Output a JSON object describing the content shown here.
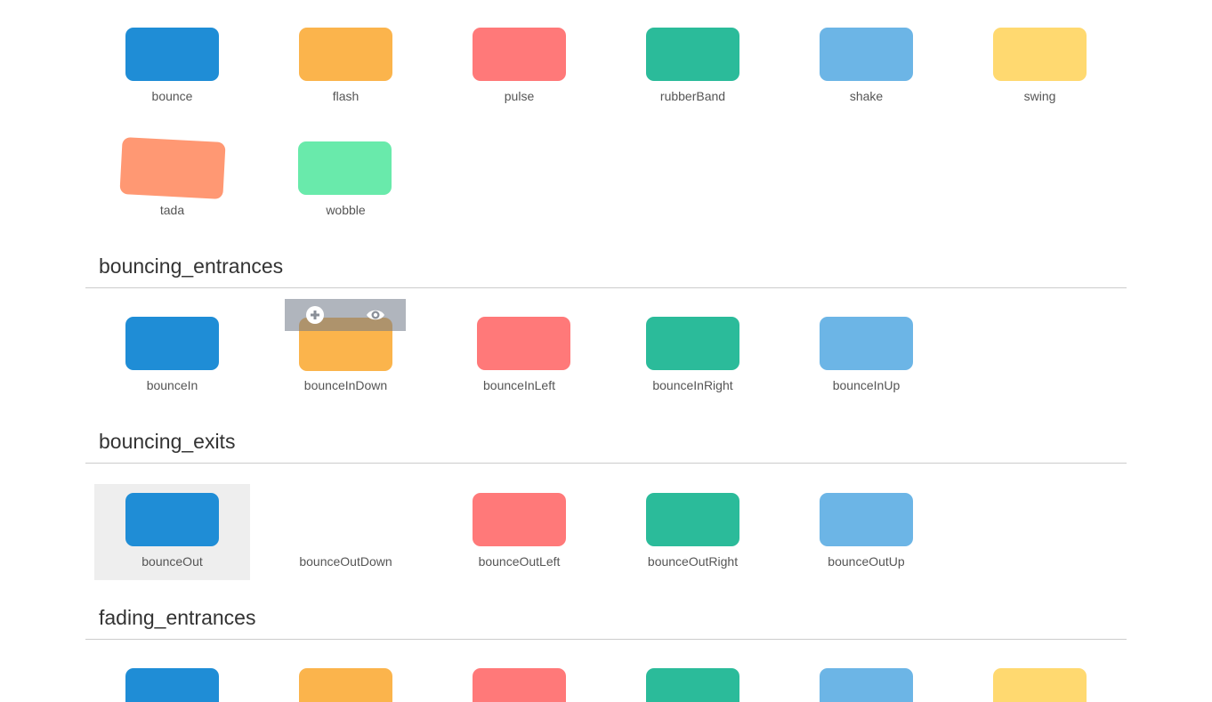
{
  "colors": {
    "blue": "#1f8dd6",
    "orange": "#fbb44c",
    "red": "#ff7979",
    "teal": "#2bbb9a",
    "lightblue": "#6cb5e6",
    "yellow": "#ffd970",
    "salmon": "#ff9873",
    "mint": "#69eaab",
    "highlight_bg": "#eeeeee"
  },
  "attention_seekers": {
    "items": [
      {
        "label": "bounce",
        "color": "blue"
      },
      {
        "label": "flash",
        "color": "orange"
      },
      {
        "label": "pulse",
        "color": "red"
      },
      {
        "label": "rubberBand",
        "color": "teal"
      },
      {
        "label": "shake",
        "color": "lightblue"
      },
      {
        "label": "swing",
        "color": "yellow"
      },
      {
        "label": "tada",
        "color": "salmon"
      },
      {
        "label": "wobble",
        "color": "mint"
      }
    ]
  },
  "bouncing_entrances": {
    "title": "bouncing_entrances",
    "items": [
      {
        "label": "bounceIn",
        "color": "blue"
      },
      {
        "label": "bounceInDown",
        "color": "orange"
      },
      {
        "label": "bounceInLeft",
        "color": "red"
      },
      {
        "label": "bounceInRight",
        "color": "teal"
      },
      {
        "label": "bounceInUp",
        "color": "lightblue"
      }
    ],
    "hover_toolbar": {
      "add_icon": "plus-circle-icon",
      "preview_icon": "eye-icon"
    }
  },
  "bouncing_exits": {
    "title": "bouncing_exits",
    "items": [
      {
        "label": "bounceOut",
        "color": "blue"
      },
      {
        "label": "bounceOutDown",
        "color": "orange"
      },
      {
        "label": "bounceOutLeft",
        "color": "red"
      },
      {
        "label": "bounceOutRight",
        "color": "teal"
      },
      {
        "label": "bounceOutUp",
        "color": "lightblue"
      }
    ]
  },
  "fading_entrances": {
    "title": "fading_entrances",
    "items": [
      {
        "color": "blue"
      },
      {
        "color": "orange"
      },
      {
        "color": "red"
      },
      {
        "color": "teal"
      },
      {
        "color": "lightblue"
      },
      {
        "color": "yellow"
      }
    ]
  }
}
